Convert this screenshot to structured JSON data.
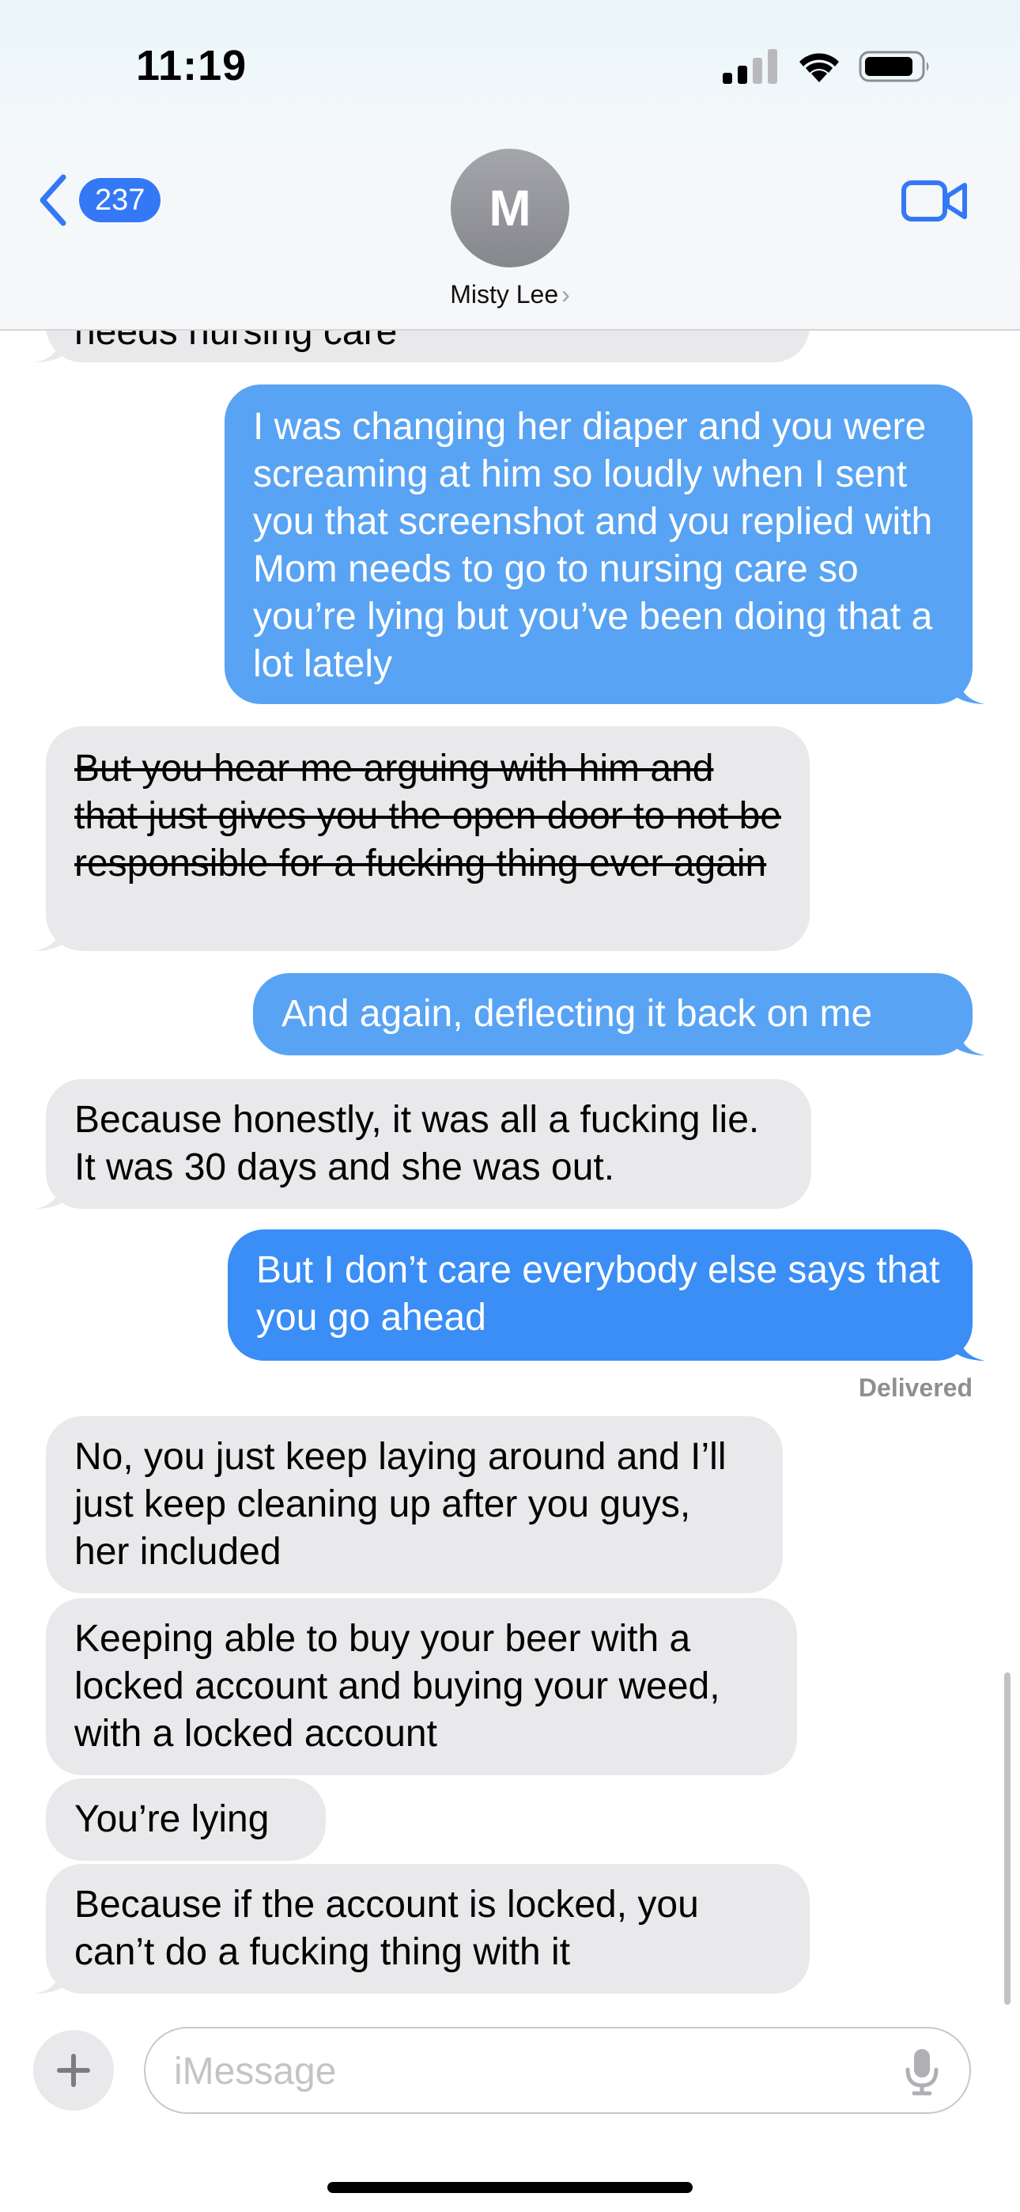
{
  "status_bar": {
    "time": "11:19"
  },
  "header": {
    "back_count": "237",
    "avatar_initial": "M",
    "contact_name": "Misty Lee"
  },
  "messages": {
    "m0": "needs nursing care",
    "m1": "I was changing her diaper and you were screaming at him so loudly when I sent you that screenshot and you replied with Mom needs to go to nursing care so you’re lying but you’ve been doing that a lot lately",
    "m2": "But you hear me arguing with him and that just gives you the open door to not be responsible for a fucking thing ever again",
    "m3": "And again, deflecting it back on me",
    "m4": "Because honestly, it was all a fucking lie. It was 30 days and she was out.",
    "m5": "But I don’t care everybody else says that you go ahead",
    "delivered": "Delivered",
    "m6": "No, you just keep laying around and I’ll just keep cleaning up after you guys, her included",
    "m7": "Keeping able to buy your beer with a locked account and buying your weed, with a locked account",
    "m8": "You’re lying",
    "m9": "Because if the account is locked, you can’t do a fucking thing with it"
  },
  "composer": {
    "placeholder": "iMessage"
  },
  "colors": {
    "accent": "#3478f6",
    "sent_bubble": "#58a3f3",
    "received_bubble": "#e9e9eb"
  },
  "icons": [
    "signal-icon",
    "wifi-icon",
    "battery-icon",
    "chevron-left-icon",
    "video-camera-icon",
    "plus-icon",
    "microphone-icon"
  ]
}
